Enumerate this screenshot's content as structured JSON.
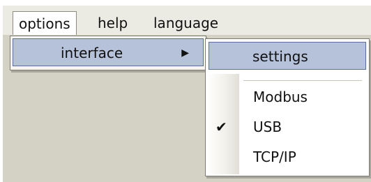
{
  "menubar": {
    "items": [
      {
        "label": "options",
        "open": true
      },
      {
        "label": "help"
      },
      {
        "label": "language"
      }
    ]
  },
  "options_menu": {
    "items": [
      {
        "label": "interface",
        "has_submenu": true,
        "highlighted": true
      }
    ],
    "submenu_arrow_icon": "triangle-right"
  },
  "interface_submenu": {
    "items": [
      {
        "label": "settings",
        "highlighted": true
      },
      {
        "label": "Modbus",
        "checked": false
      },
      {
        "label": "USB",
        "checked": true
      },
      {
        "label": "TCP/IP",
        "checked": false
      }
    ],
    "check_icon": "checkmark"
  },
  "colors": {
    "highlight": "#b6c2d9",
    "highlight_border": "#596f99",
    "workspace": "#d4d2c4",
    "menubar": "#ecebe3"
  }
}
